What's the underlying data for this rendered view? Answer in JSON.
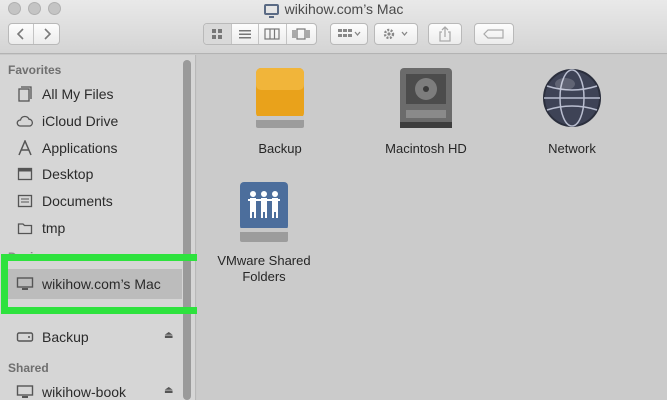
{
  "window": {
    "title": "wikihow.com’s Mac"
  },
  "toolbar": {
    "back_icon": "chevron-left-icon",
    "forward_icon": "chevron-right-icon",
    "view_modes": [
      "icon-view",
      "list-view",
      "column-view",
      "cover-flow-view"
    ],
    "arrange_icon": "grid-arrange-icon",
    "action_icon": "gear-icon",
    "share_icon": "share-icon",
    "tag_icon": "tag-icon"
  },
  "sidebar": {
    "favorites_header": "Favorites",
    "favorites": [
      {
        "label": "All My Files",
        "icon": "all-files-icon"
      },
      {
        "label": "iCloud Drive",
        "icon": "cloud-icon"
      },
      {
        "label": "Applications",
        "icon": "applications-icon"
      },
      {
        "label": "Desktop",
        "icon": "desktop-icon"
      },
      {
        "label": "Documents",
        "icon": "documents-icon"
      },
      {
        "label": "tmp",
        "icon": "folder-icon"
      }
    ],
    "devices_header": "Devices",
    "devices": [
      {
        "label": "wikihow.com’s Mac",
        "icon": "computer-icon"
      },
      {
        "label": "Backup",
        "icon": "drive-icon"
      }
    ],
    "shared_header": "Shared",
    "shared": [
      {
        "label": "wikihow-book",
        "icon": "computer-icon"
      }
    ]
  },
  "main": {
    "items": [
      {
        "label": "Backup",
        "icon": "orange-drive-icon"
      },
      {
        "label": "Macintosh HD",
        "icon": "hard-drive-icon"
      },
      {
        "label": "Network",
        "icon": "network-globe-icon"
      },
      {
        "label": "VMware Shared Folders",
        "icon": "shared-folder-drive-icon"
      }
    ]
  },
  "colors": {
    "highlight": "#2ee23e",
    "backup_drive": "#e9a21b",
    "shared_drive": "#4c6e9c"
  }
}
